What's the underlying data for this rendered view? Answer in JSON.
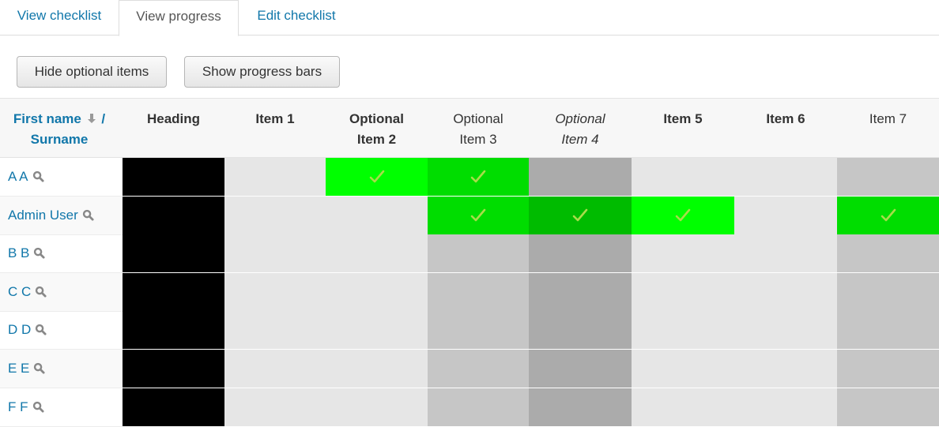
{
  "tabs": [
    {
      "label": "View checklist",
      "active": false
    },
    {
      "label": "View progress",
      "active": true
    },
    {
      "label": "Edit checklist",
      "active": false
    }
  ],
  "buttons": {
    "hide_optional": "Hide optional items",
    "show_progress": "Show progress bars"
  },
  "header": {
    "first_name": "First name",
    "separator": "/",
    "surname": "Surname",
    "columns": [
      {
        "lines": [
          "Heading"
        ],
        "style": "bold"
      },
      {
        "lines": [
          "Item 1"
        ],
        "style": "bold"
      },
      {
        "lines": [
          "Optional",
          "Item 2"
        ],
        "style": "bold"
      },
      {
        "lines": [
          "Optional",
          "Item 3"
        ],
        "style": "normal"
      },
      {
        "lines": [
          "Optional",
          "Item 4"
        ],
        "style": "italic"
      },
      {
        "lines": [
          "Item 5"
        ],
        "style": "bold"
      },
      {
        "lines": [
          "Item 6"
        ],
        "style": "bold"
      },
      {
        "lines": [
          "Item 7"
        ],
        "style": "normal"
      }
    ]
  },
  "colors": {
    "link": "#1177aa",
    "heading_cell": "#000000",
    "unchecked": [
      "#000000",
      "#e6e6e6",
      "#e6e6e6",
      "#c6c6c6",
      "#ababab",
      "#e6e6e6",
      "#e6e6e6",
      "#c6c6c6"
    ],
    "check_mark": "#a8dc4a"
  },
  "users": [
    {
      "name": "A A",
      "checked": [
        null,
        null,
        "#00ff00",
        "#00dd00",
        null,
        null,
        null,
        null
      ]
    },
    {
      "name": "Admin User",
      "checked": [
        null,
        null,
        null,
        "#00dd00",
        "#00bb00",
        "#00ff00",
        null,
        "#00dd00"
      ]
    },
    {
      "name": "B B",
      "checked": [
        null,
        null,
        null,
        null,
        null,
        null,
        null,
        null
      ]
    },
    {
      "name": "C C",
      "checked": [
        null,
        null,
        null,
        null,
        null,
        null,
        null,
        null
      ]
    },
    {
      "name": "D D",
      "checked": [
        null,
        null,
        null,
        null,
        null,
        null,
        null,
        null
      ]
    },
    {
      "name": "E E",
      "checked": [
        null,
        null,
        null,
        null,
        null,
        null,
        null,
        null
      ]
    },
    {
      "name": "F F",
      "checked": [
        null,
        null,
        null,
        null,
        null,
        null,
        null,
        null
      ]
    }
  ]
}
